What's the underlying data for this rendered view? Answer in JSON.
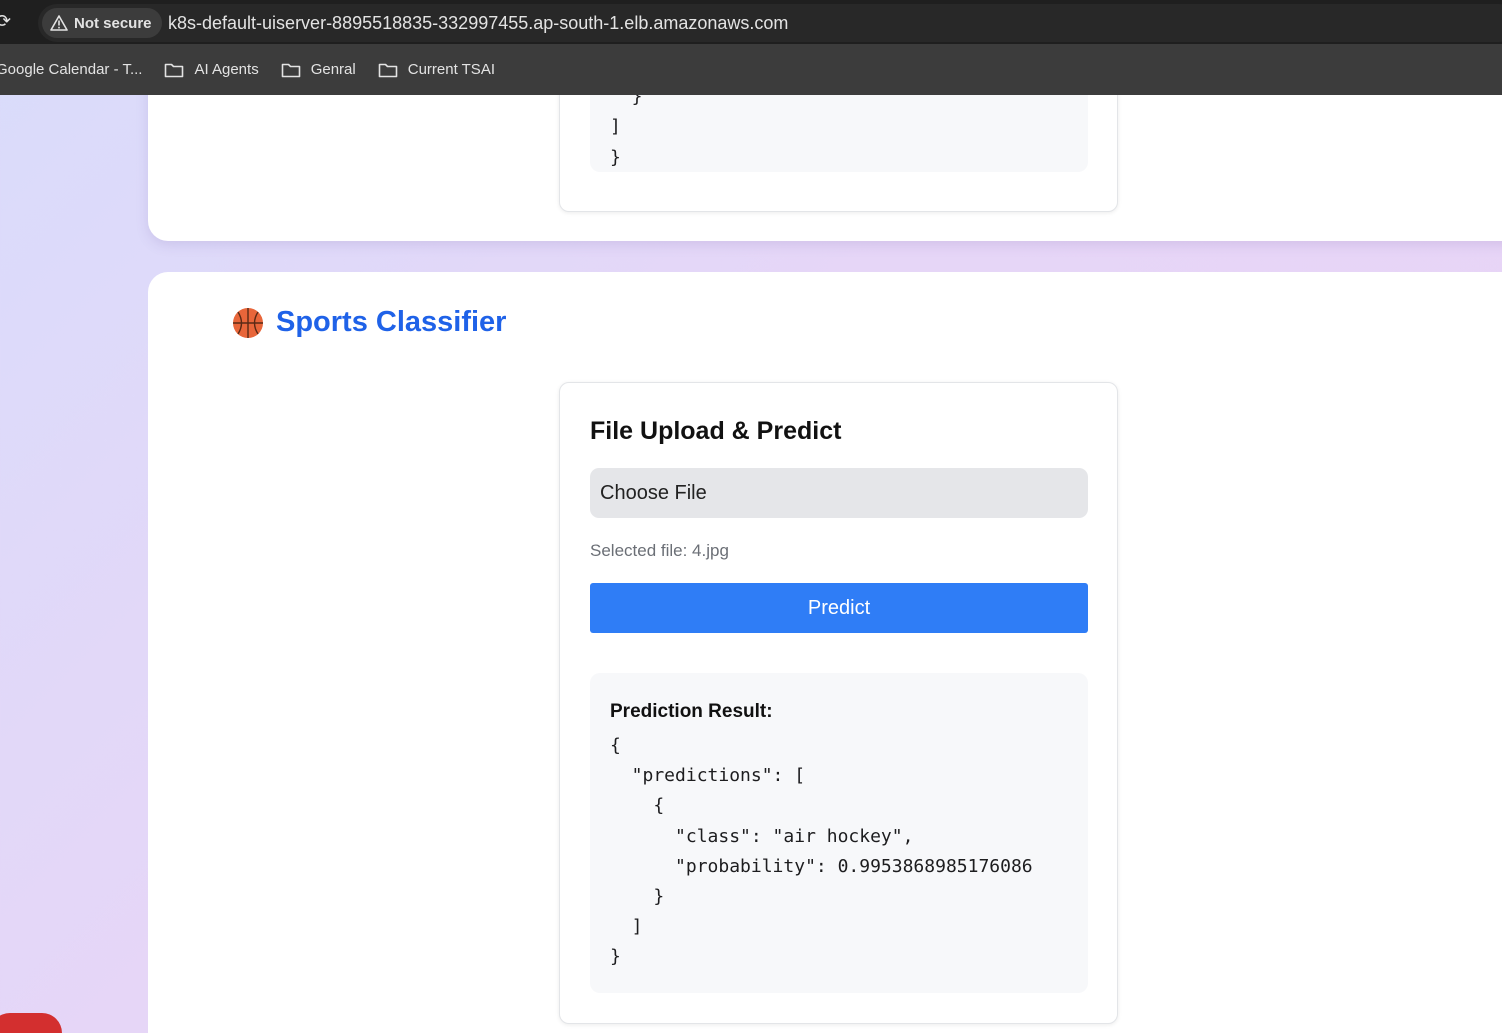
{
  "browser": {
    "security_label": "Not secure",
    "url": "k8s-default-uiserver-8895518835-332997455.ap-south-1.elb.amazonaws.com",
    "bookmarks": [
      {
        "label": "Google Calendar - T..."
      },
      {
        "label": "AI Agents"
      },
      {
        "label": "Genral"
      },
      {
        "label": "Current TSAI"
      }
    ]
  },
  "top_section": {
    "code": "    ]\n  }\n]\n}"
  },
  "sports_section": {
    "title": "Sports Classifier",
    "panel_heading": "File Upload & Predict",
    "choose_file_label": "Choose File",
    "selected_file": "Selected file: 4.jpg",
    "predict_label": "Predict",
    "result_label": "Prediction Result:",
    "result_json": "{\n  \"predictions\": [\n    {\n      \"class\": \"air hockey\",\n      \"probability\": 0.9953868985176086\n    }\n  ]\n}"
  },
  "colors": {
    "accent": "#1f62e8",
    "predict_button": "#2f7df6"
  }
}
